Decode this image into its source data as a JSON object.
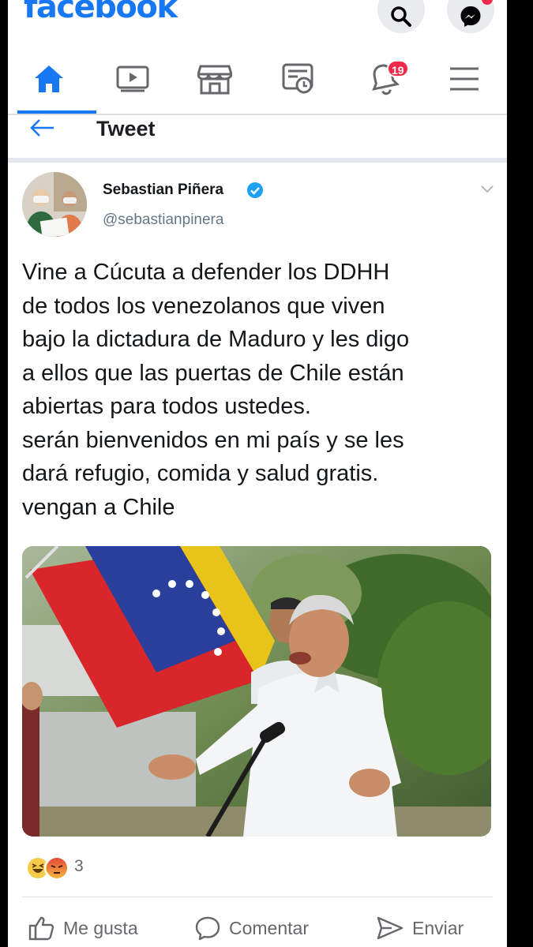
{
  "app": {
    "logo": "facebook",
    "brand_color": "#1877f2"
  },
  "topbar": {
    "search_icon": "search-icon",
    "messenger_icon": "messenger-icon"
  },
  "nav": {
    "items": [
      {
        "name": "home",
        "icon": "home-icon",
        "active": true
      },
      {
        "name": "watch",
        "icon": "video-icon"
      },
      {
        "name": "marketplace",
        "icon": "store-icon"
      },
      {
        "name": "memories",
        "icon": "news-clock-icon"
      },
      {
        "name": "notifications",
        "icon": "bell-icon",
        "badge": "19"
      },
      {
        "name": "menu",
        "icon": "hamburger-icon"
      }
    ]
  },
  "tweet_header": {
    "title": "Tweet"
  },
  "post": {
    "author_name": "Sebastian Piñera",
    "handle": "@sebastianpinera",
    "verified": true,
    "text_lines": [
      "Vine a Cúcuta a defender los DDHH",
      "de todos los venezolanos que viven",
      "bajo la dictadura de Maduro y les digo",
      "a ellos que las puertas de Chile están",
      "abiertas para todos ustedes.",
      "serán bienvenidos en mi país y se les",
      "dará refugio, comida y salud gratis.",
      "vengan a Chile"
    ]
  },
  "reactions": {
    "count": "3",
    "types": [
      "haha",
      "angry"
    ]
  },
  "actions": {
    "like": "Me gusta",
    "comment": "Comentar",
    "share": "Enviar"
  }
}
